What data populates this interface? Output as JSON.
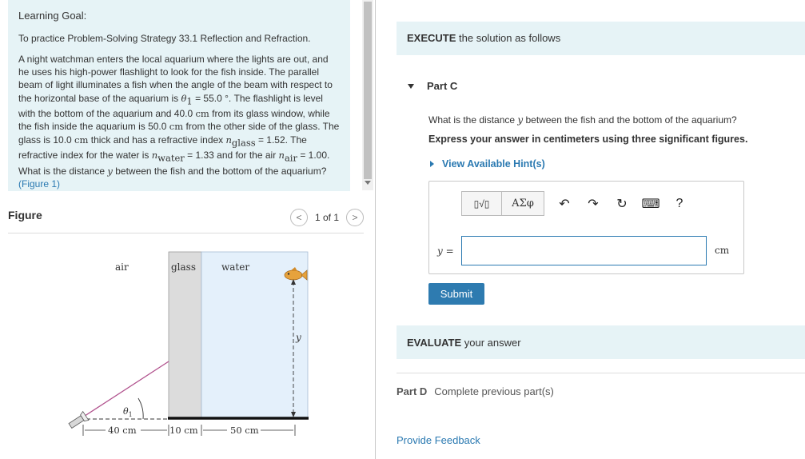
{
  "learning_goal": {
    "title": "Learning Goal:",
    "intro": "To practice Problem-Solving Strategy 33.1 Reflection and Refraction.",
    "body_1": "A night watchman enters the local aquarium where the lights are out, and he uses his high-power flashlight to look for the fish inside. The parallel beam of light illuminates a fish when the angle of the beam with respect to the horizontal base of the aquarium is ",
    "theta_sym": "θ",
    "theta_sub": "1",
    "eq_angle": " = 55.0 °",
    "body_2": ". The flashlight is level with the bottom of the aquarium and 40.0 ",
    "unit_cm_1": "cm",
    "body_3": " from its glass window, while the fish inside the aquarium is 50.0 ",
    "unit_cm_2": "cm",
    "body_4": " from the other side of the glass. The glass is 10.0 ",
    "unit_cm_3": "cm",
    "body_5": " thick and has a refractive index ",
    "n_sym": "n",
    "n_glass_sub": "glass",
    "eq_glass": " = 1.52. The refractive index for the water is ",
    "n_water_sub": "water",
    "eq_water": " = 1.33 and for the air ",
    "n_air_sub": "air",
    "eq_air": " = 1.00. What is the distance ",
    "y_sym": "y",
    "body_6": " between the fish and the bottom of the aquarium? ",
    "figure_link": "(Figure 1)"
  },
  "figure_panel": {
    "title": "Figure",
    "pager_text": "1 of 1",
    "prev_glyph": "<",
    "next_glyph": ">",
    "labels": {
      "air": "air",
      "glass": "glass",
      "water": "water",
      "y": "y",
      "theta": "θ",
      "theta_sub": "1",
      "dist_air": "40 cm",
      "dist_glass": "10 cm",
      "dist_water": "50 cm"
    }
  },
  "execute": {
    "bold": "EXECUTE",
    "rest": " the solution as follows"
  },
  "part_c": {
    "label": "Part C",
    "question_1": "What is the distance ",
    "question_y": "y",
    "question_2": " between the fish and the bottom of the aquarium?",
    "instruction": "Express your answer in centimeters using three significant figures.",
    "hint": "View Available Hint(s)",
    "toolbar": {
      "templates": "▯√▯",
      "symbols": "ΑΣφ",
      "undo": "↶",
      "redo": "↷",
      "reset": "↻",
      "keyboard": "⌨",
      "help": "?"
    },
    "answer_var": "y",
    "answer_eq": " =",
    "answer_value": "",
    "unit": "cm",
    "submit": "Submit"
  },
  "evaluate": {
    "bold": "EVALUATE",
    "rest": " your answer"
  },
  "part_d": {
    "label": "Part D",
    "status": "Complete previous part(s)"
  },
  "feedback": "Provide Feedback",
  "colors": {
    "panel_bg": "#e6f3f6",
    "link": "#2a79b1",
    "submit_bg": "#2e7bb0",
    "glass": "#dcdcdc",
    "water": "#e4f0fb",
    "beam": "#b0508c",
    "fish": "#e6a23c"
  }
}
